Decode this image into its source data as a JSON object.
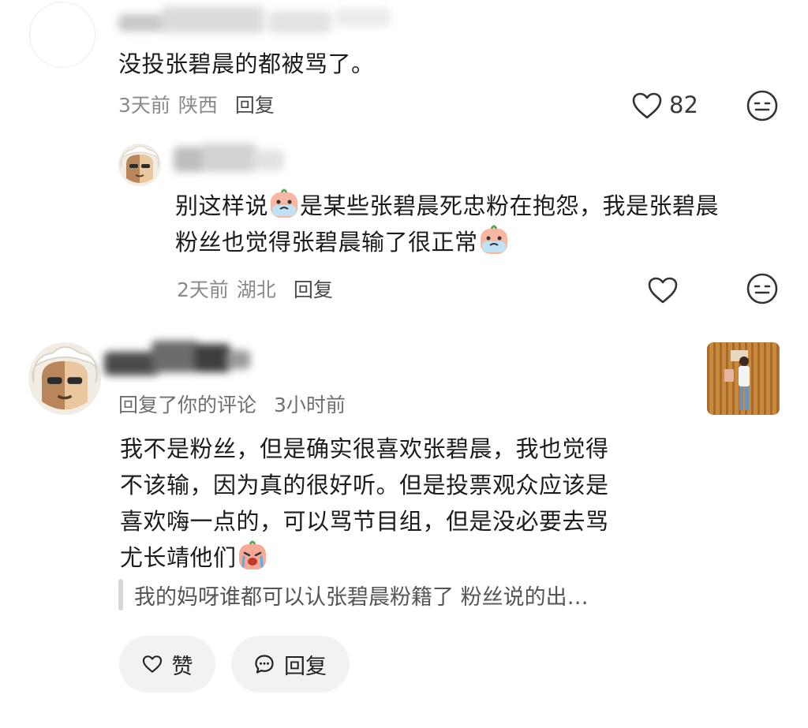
{
  "comment1": {
    "text": "没投张碧晨的都被骂了。",
    "time": "3天前",
    "location": "陕西",
    "reply_label": "回复",
    "like_count": "82"
  },
  "comment2": {
    "text_line1_a": "别这样说",
    "text_line1_b": "是某些张碧晨死忠粉在抱怨，我是张碧晨",
    "text_line2": "粉丝也觉得张碧晨输了很正常",
    "time": "2天前",
    "location": "湖北",
    "reply_label": "回复"
  },
  "notification": {
    "action": "回复了你的评论",
    "time": "3小时前",
    "text_line1": "我不是粉丝，但是确实很喜欢张碧晨，我也觉得",
    "text_line2": "不该输，因为真的很好听。但是投票观众应该是",
    "text_line3": "喜欢嗨一点的，可以骂节目组，但是没必要去骂",
    "text_line4": "尤长靖他们",
    "quoted": "我的妈呀谁都可以认张碧晨粉籍了 粉丝说的出…",
    "like_label": "赞",
    "reply_label": "回复"
  },
  "icons": {
    "heart": "heart-icon",
    "expression": "neutral-face-icon",
    "emoji": "crying-emoji-icon",
    "reply": "speech-bubble-icon"
  },
  "colors": {
    "text": "#1c1c1c",
    "meta": "#8a8a8a",
    "pill_bg": "#f2f2f2"
  }
}
